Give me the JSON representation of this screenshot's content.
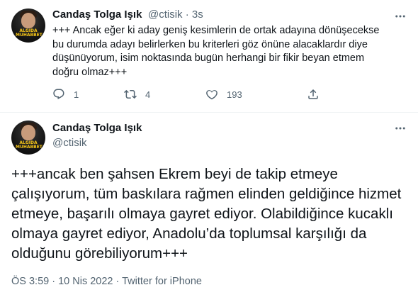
{
  "tweets": [
    {
      "author_name": "Candaş Tolga Işık",
      "author_handle": "@ctisik",
      "meta": "@ctisik · 3s",
      "text": "+++ Ancak eğer ki aday geniş kesimlerin de ortak adayına dönüşecekse bu durumda adayı belirlerken bu kriterleri göz önüne alacaklardır diye düşünüyorum, isim noktasında bugün herhangi bir fikir beyan etmem doğru olmaz+++",
      "replies": "1",
      "retweets": "4",
      "likes": "193",
      "avatar_badge": "ALGIDA MUHABBET"
    },
    {
      "author_name": "Candaş Tolga Işık",
      "author_handle": "@ctisik",
      "text": "+++ancak ben şahsen Ekrem beyi de takip etmeye çalışıyorum, tüm baskılara rağmen elinden geldiğince hizmet etmeye, başarılı olmaya gayret ediyor. Olabildiğince kucaklı olmaya gayret ediyor, Anadolu’da toplumsal karşılığı da olduğunu görebiliyorum+++",
      "time": "ÖS 3:59",
      "date": "10 Nis 2022",
      "source": "Twitter for iPhone",
      "avatar_badge": "ALGIDA MUHABBET"
    }
  ],
  "icons": {
    "more": "more-icon",
    "reply": "reply-icon",
    "retweet": "retweet-icon",
    "like": "like-icon",
    "share": "share-icon"
  }
}
